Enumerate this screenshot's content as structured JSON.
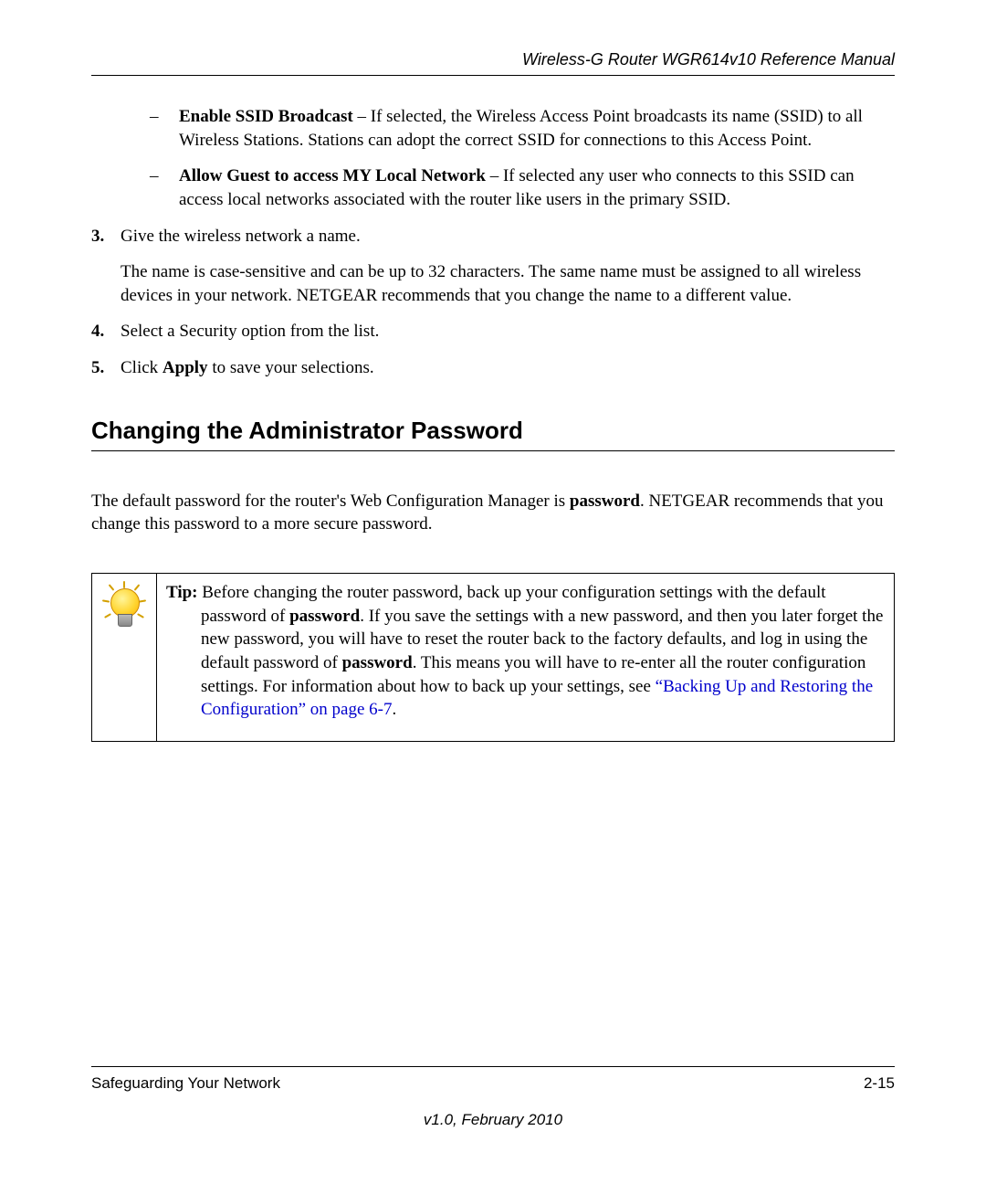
{
  "header": {
    "title": "Wireless-G Router WGR614v10 Reference Manual"
  },
  "bullets": {
    "b1": {
      "dash": "–",
      "bold": "Enable SSID Broadcast",
      "text": " – If selected, the Wireless Access Point broadcasts its name (SSID) to all Wireless Stations. Stations can adopt the correct SSID for connections to this Access Point."
    },
    "b2": {
      "dash": "–",
      "bold": "Allow Guest to access MY Local Network",
      "text": " – If selected any user who connects to this SSID can access local networks associated with the router like users in the primary SSID."
    }
  },
  "steps": {
    "s3": {
      "num": "3.",
      "text": "Give the wireless network a name.",
      "para": "The name is case-sensitive and can be up to 32 characters. The same name must be assigned to all wireless devices in your network. NETGEAR recommends that you change the name to a different value."
    },
    "s4": {
      "num": "4.",
      "text": "Select a Security option from the list."
    },
    "s5": {
      "num": "5.",
      "pre": "Click ",
      "bold": "Apply",
      "post": " to save your selections."
    }
  },
  "section": {
    "heading": "Changing the Administrator Password",
    "intro_pre": "The default password for the router's Web Configuration Manager is ",
    "intro_bold": "password",
    "intro_post": ". NETGEAR recommends that you change this password to a more secure password."
  },
  "tip": {
    "label": "Tip:",
    "t1": " Before changing the router password, back up your configuration settings with the default password of ",
    "b1": "password",
    "t2": ". If you save the settings with a new password, and then you later forget the new password, you will have to reset the router back to the factory defaults, and log in using the default password of ",
    "b2": "password",
    "t3": ". This means you will have to re-enter all the router configuration settings. For information about how to back up your settings, see ",
    "link": "“Backing Up and Restoring the Configuration” on page 6-7",
    "t4": "."
  },
  "footer": {
    "left": "Safeguarding Your Network",
    "right": "2-15",
    "version": "v1.0, February 2010"
  }
}
